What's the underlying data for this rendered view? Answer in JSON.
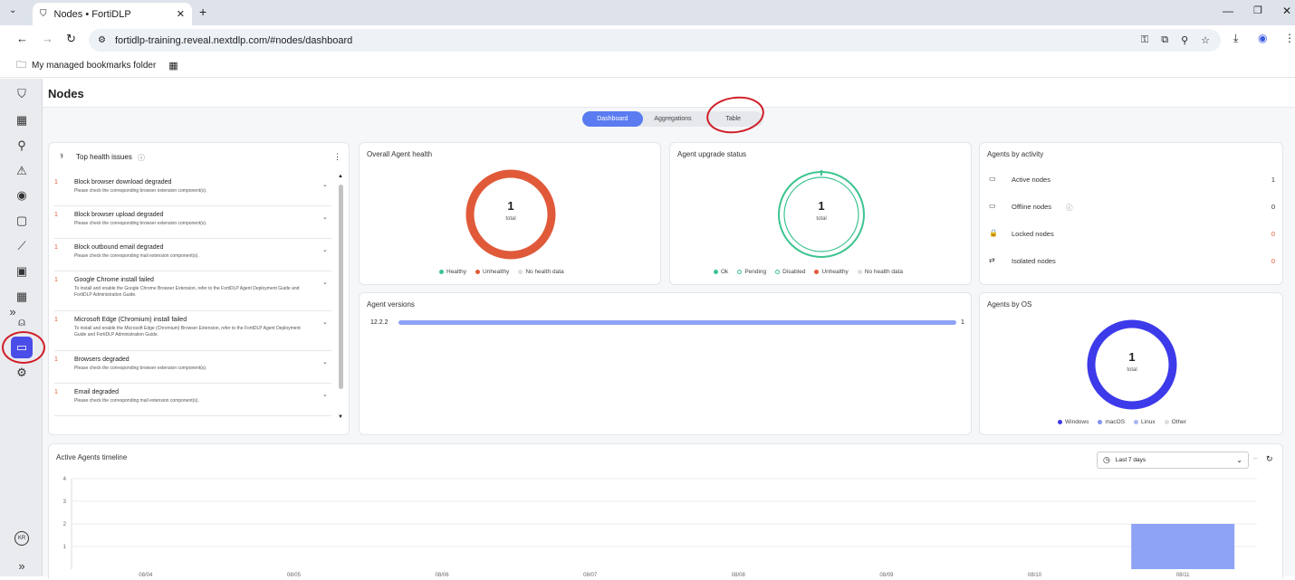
{
  "browser": {
    "tab_title": "Nodes • FortiDLP",
    "new_tab": "+",
    "url": "fortidlp-training.reveal.nextdlp.com/#nodes/dashboard",
    "bookmarks_folder": "My managed bookmarks folder"
  },
  "page": {
    "title": "Nodes"
  },
  "tabs": [
    {
      "label": "Dashboard",
      "active": true
    },
    {
      "label": "Aggregations",
      "active": false
    },
    {
      "label": "Table",
      "active": false
    }
  ],
  "health_issues": {
    "title": "Top health issues",
    "items": [
      {
        "count": "1",
        "title": "Block browser download degraded",
        "desc": "Please check the corresponding browser extension component(s)."
      },
      {
        "count": "1",
        "title": "Block browser upload degraded",
        "desc": "Please check the corresponding browser extension component(s)."
      },
      {
        "count": "1",
        "title": "Block outbound email degraded",
        "desc": "Please check the corresponding mail extension component(s)."
      },
      {
        "count": "1",
        "title": "Google Chrome install failed",
        "desc": "To install and enable the Google Chrome Browser Extension, refer to the FortiDLP Agent Deployment Guide and FortiDLP Administration Guide."
      },
      {
        "count": "1",
        "title": "Microsoft Edge (Chromium) install failed",
        "desc": "To install and enable the Microsoft Edge (Chromium) Browser Extension, refer to the FortiDLP Agent Deployment Guide and FortiDLP Administration Guide."
      },
      {
        "count": "1",
        "title": "Browsers degraded",
        "desc": "Please check the corresponding browser extension component(s)."
      },
      {
        "count": "1",
        "title": "Email degraded",
        "desc": "Please check the corresponding mail extension component(s)."
      }
    ]
  },
  "overall_health": {
    "title": "Overall Agent health",
    "total": "1",
    "total_label": "total",
    "legend": [
      "Healthy",
      "Unhealthy",
      "No health data"
    ],
    "colors": [
      "#3cc48f",
      "#e05a3a",
      "#dddddd"
    ]
  },
  "upgrade_status": {
    "title": "Agent upgrade status",
    "total": "1",
    "total_label": "total",
    "legend": [
      "Ok",
      "Pending",
      "Disabled",
      "Unhealthy",
      "No health data"
    ],
    "colors": [
      "#3cc48f",
      "#8fe0bd",
      "#3cc48f",
      "#e05a3a",
      "#dddddd"
    ]
  },
  "activity": {
    "title": "Agents by activity",
    "rows": [
      {
        "icon": "▭",
        "label": "Active nodes",
        "value": "1"
      },
      {
        "icon": "▭",
        "label": "Offline nodes",
        "value": "0"
      },
      {
        "icon": "🔒",
        "label": "Locked nodes",
        "value": "0"
      },
      {
        "icon": "⇄",
        "label": "Isolated nodes",
        "value": "0"
      }
    ]
  },
  "versions": {
    "title": "Agent versions",
    "rows": [
      {
        "version": "12.2.2",
        "count": "1",
        "fraction": 1.0
      }
    ]
  },
  "os": {
    "title": "Agents by OS",
    "total": "1",
    "total_label": "total",
    "legend": [
      "Windows",
      "macOS",
      "Linux",
      "Other"
    ],
    "colors": [
      "#3d3aea",
      "#7f93f0",
      "#a9b5f2",
      "#dddddd"
    ]
  },
  "timeline": {
    "title": "Active Agents timeline",
    "range_label": "Last 7 days"
  },
  "chart_data": {
    "type": "bar",
    "categories": [
      "08/04",
      "08/05",
      "08/06",
      "08/07",
      "08/08",
      "08/09",
      "08/10",
      "08/11"
    ],
    "values": [
      0,
      0,
      0,
      0,
      0,
      0,
      0,
      2
    ],
    "ylim": [
      0,
      4
    ],
    "yticks": [
      "1",
      "2",
      "3",
      "4"
    ],
    "color": "#8ea3f5"
  },
  "sidebar": {
    "user_initials": "KR",
    "expand": "»"
  }
}
